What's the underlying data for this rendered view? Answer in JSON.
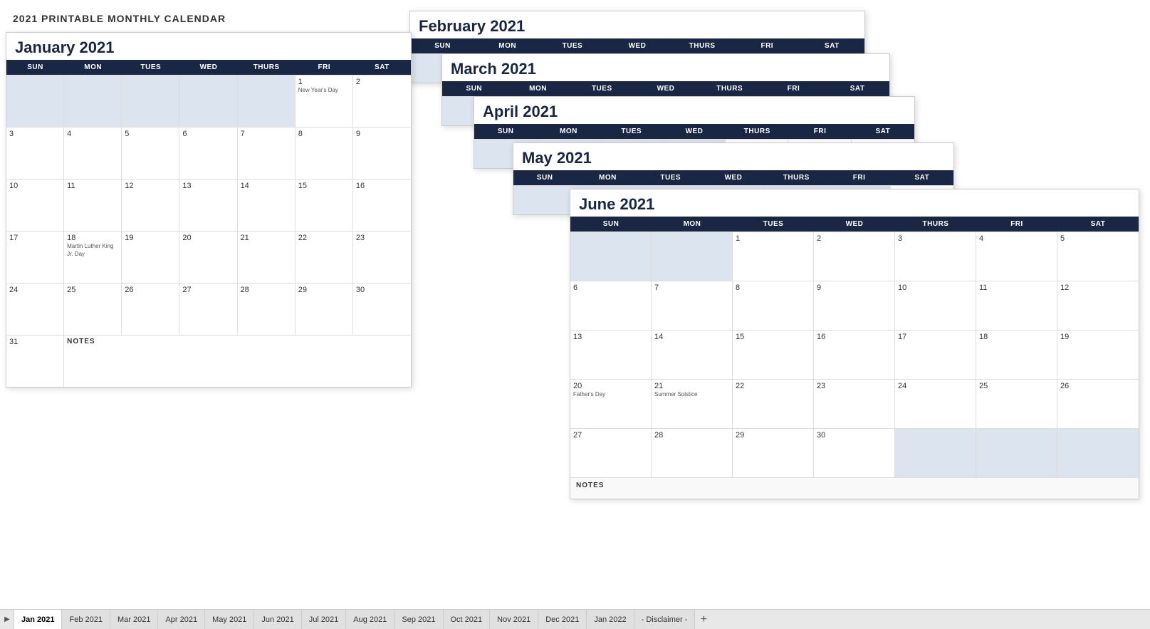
{
  "page": {
    "title": "2021 PRINTABLE MONTHLY CALENDAR"
  },
  "calendars": {
    "january": {
      "title": "January 2021",
      "headers": [
        "SUN",
        "MON",
        "TUES",
        "WED",
        "THURS",
        "FRI",
        "SAT"
      ],
      "notes_label": "NOTES"
    },
    "february": {
      "title": "February 2021",
      "headers": [
        "SUN",
        "MON",
        "TUES",
        "WED",
        "THURS",
        "FRI",
        "SAT"
      ]
    },
    "march": {
      "title": "March 2021",
      "headers": [
        "SUN",
        "MON",
        "TUES",
        "WED",
        "THURS",
        "FRI",
        "SAT"
      ]
    },
    "april": {
      "title": "April 2021",
      "headers": [
        "SUN",
        "MON",
        "TUES",
        "WED",
        "THURS",
        "FRI",
        "SAT"
      ]
    },
    "may": {
      "title": "May 2021",
      "headers": [
        "SUN",
        "MON",
        "TUES",
        "WED",
        "THURS",
        "FRI",
        "SAT"
      ]
    },
    "june": {
      "title": "June 2021",
      "headers": [
        "SUN",
        "MON",
        "TUES",
        "WED",
        "THURS",
        "FRI",
        "SAT"
      ],
      "notes_label": "NOTES"
    }
  },
  "tabs": {
    "items": [
      {
        "label": "Jan 2021",
        "active": true
      },
      {
        "label": "Feb 2021",
        "active": false
      },
      {
        "label": "Mar 2021",
        "active": false
      },
      {
        "label": "Apr 2021",
        "active": false
      },
      {
        "label": "May 2021",
        "active": false
      },
      {
        "label": "Jun 2021",
        "active": false
      },
      {
        "label": "Jul 2021",
        "active": false
      },
      {
        "label": "Aug 2021",
        "active": false
      },
      {
        "label": "Sep 2021",
        "active": false
      },
      {
        "label": "Oct 2021",
        "active": false
      },
      {
        "label": "Nov 2021",
        "active": false
      },
      {
        "label": "Dec 2021",
        "active": false
      },
      {
        "label": "Jan 2022",
        "active": false
      },
      {
        "label": "- Disclaimer -",
        "active": false
      }
    ],
    "add_label": "+"
  }
}
